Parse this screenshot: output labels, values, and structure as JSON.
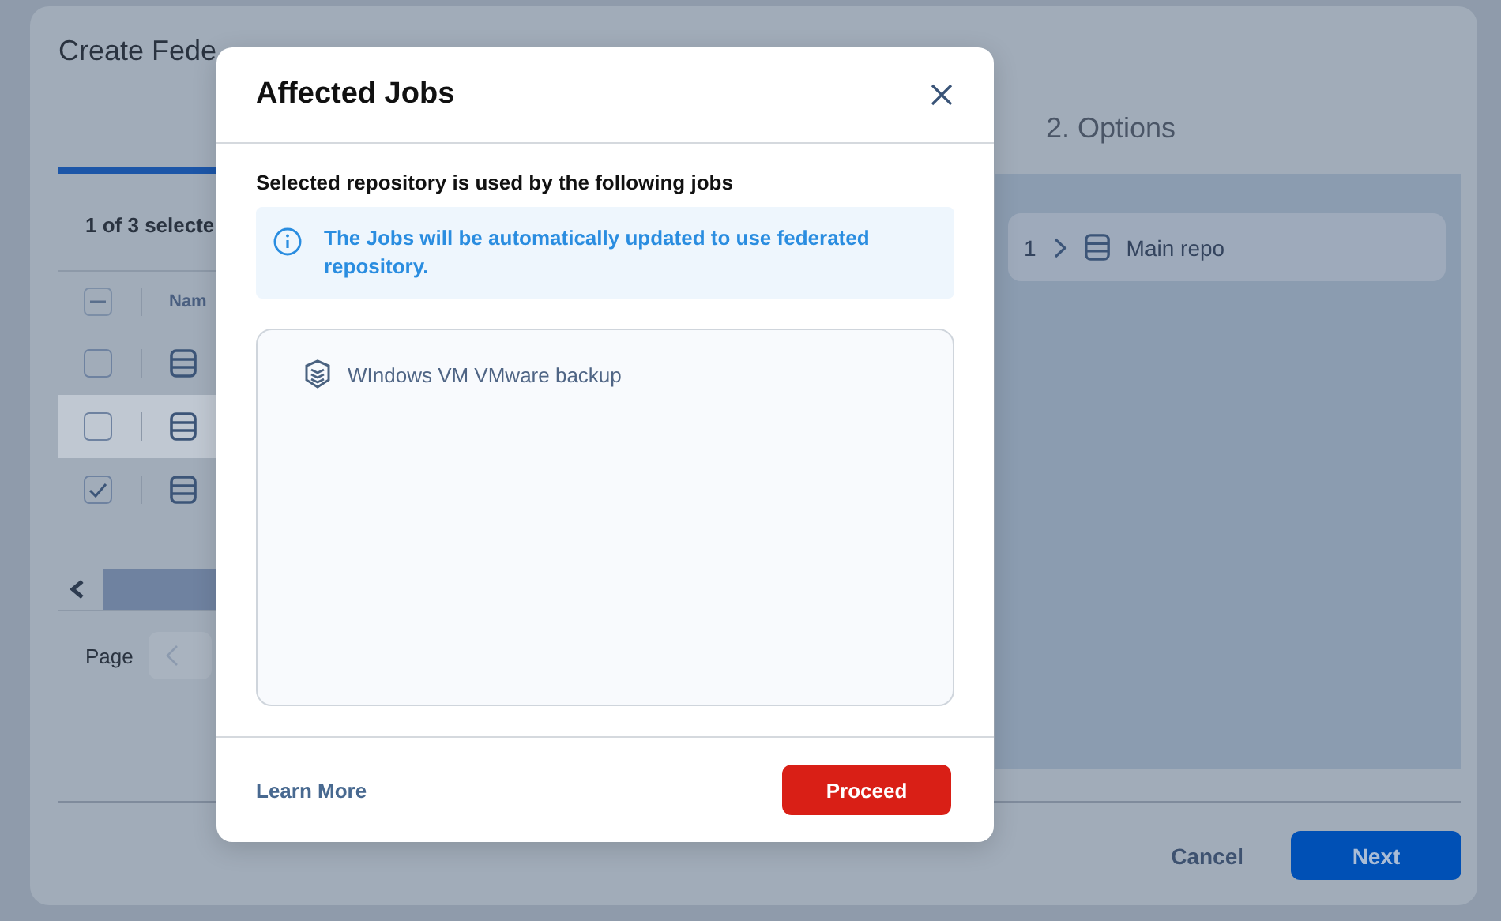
{
  "wizard": {
    "title": "Create Fede",
    "steps": [
      {
        "label": "2. Options",
        "selected": false
      }
    ],
    "progress": {
      "level": 1
    },
    "selection_summary": "1 of 3 selecte",
    "table": {
      "header_indeterminate": true,
      "column_1": "Nam",
      "rows": [
        {
          "checked": false,
          "highlighted": false
        },
        {
          "checked": false,
          "highlighted": true
        },
        {
          "checked": true,
          "highlighted": false
        }
      ]
    },
    "pager": {
      "label": "Page"
    },
    "selected_items": [
      {
        "index": "1",
        "name": "Main repo"
      }
    ],
    "buttons": {
      "cancel": "Cancel",
      "next": "Next"
    }
  },
  "dialog": {
    "title": "Affected Jobs",
    "subtitle": "Selected repository is used by the following jobs",
    "info": "The Jobs will be automatically updated to use federated repository.",
    "jobs": [
      {
        "name": "WIndows VM VMware backup"
      }
    ],
    "learn_more": "Learn More",
    "proceed": "Proceed"
  }
}
